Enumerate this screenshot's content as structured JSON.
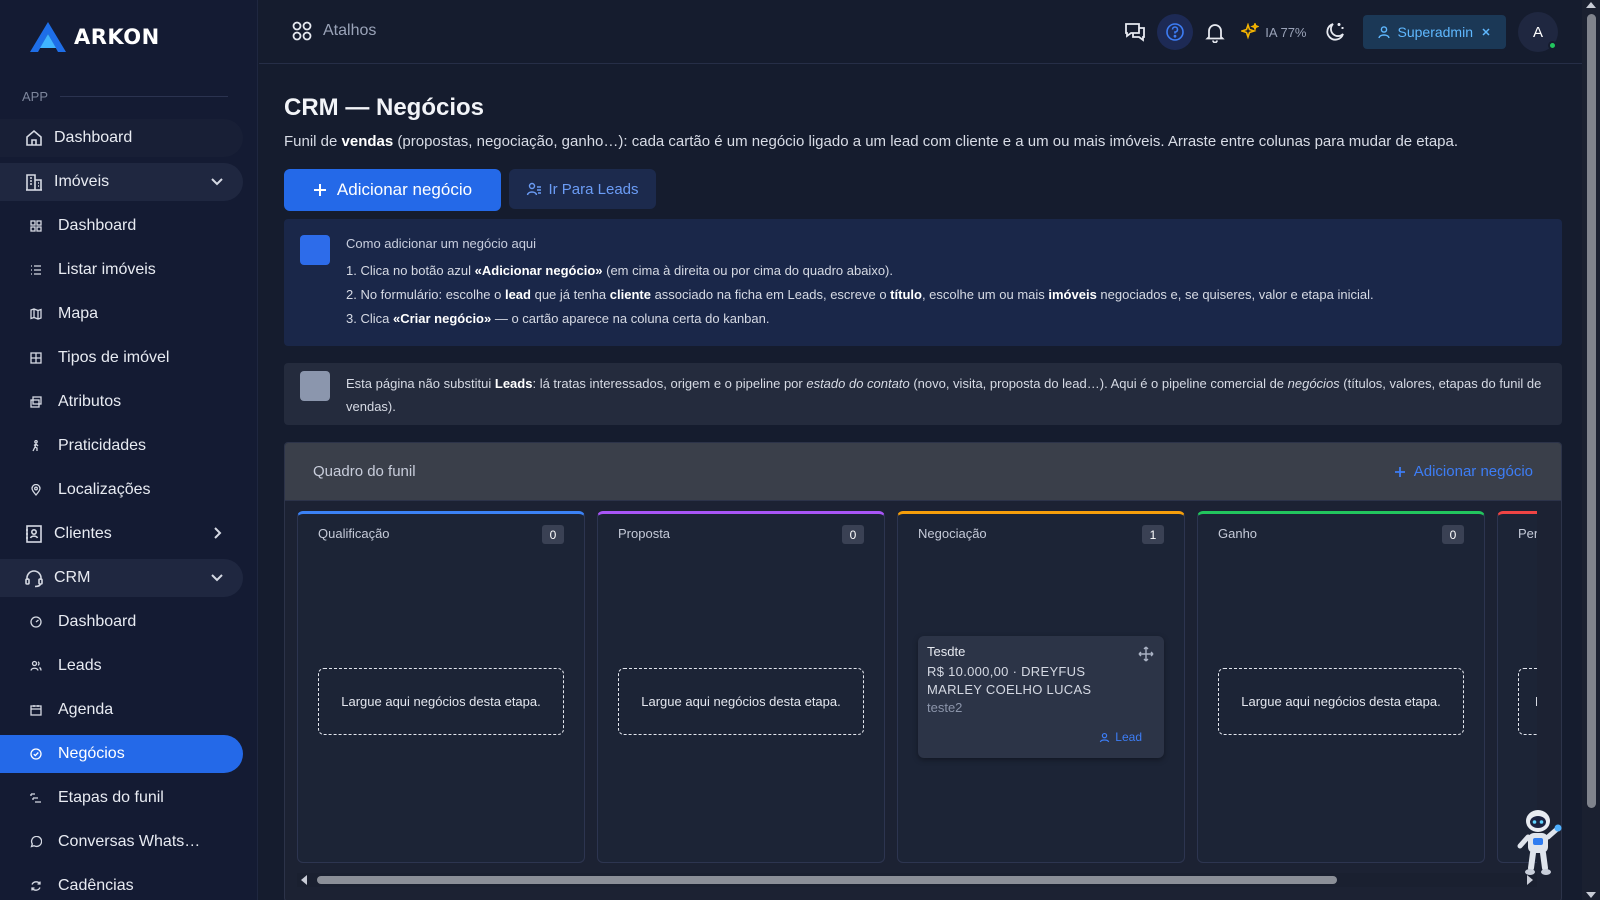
{
  "app": {
    "brand": "ARKON"
  },
  "sidebar": {
    "section_label": "APP",
    "items": [
      {
        "label": "Dashboard",
        "icon": "home-icon"
      },
      {
        "label": "Imóveis",
        "icon": "building-icon",
        "expanded": true
      },
      {
        "label": "Dashboard",
        "icon": "grid-icon"
      },
      {
        "label": "Listar imóveis",
        "icon": "list-icon"
      },
      {
        "label": "Mapa",
        "icon": "map-icon"
      },
      {
        "label": "Tipos de imóvel",
        "icon": "grid-icon"
      },
      {
        "label": "Atributos",
        "icon": "tags-icon"
      },
      {
        "label": "Praticidades",
        "icon": "person-walking-icon"
      },
      {
        "label": "Localizações",
        "icon": "pin-icon"
      },
      {
        "label": "Clientes",
        "icon": "address-book-icon",
        "expanded": false
      },
      {
        "label": "CRM",
        "icon": "headset-icon",
        "expanded": true
      },
      {
        "label": "Dashboard",
        "icon": "gauge-icon"
      },
      {
        "label": "Leads",
        "icon": "users-icon"
      },
      {
        "label": "Agenda",
        "icon": "calendar-icon"
      },
      {
        "label": "Negócios",
        "icon": "target-icon",
        "active": true
      },
      {
        "label": "Etapas do funil",
        "icon": "steps-icon"
      },
      {
        "label": "Conversas Whats…",
        "icon": "whatsapp-icon"
      },
      {
        "label": "Cadências",
        "icon": "refresh-icon"
      }
    ]
  },
  "topbar": {
    "shortcuts_label": "Atalhos",
    "ai_label": "IA 77%",
    "role_label": "Superadmin",
    "avatar_initial": "A"
  },
  "main": {
    "title": "CRM — Negócios",
    "desc_pre": "Funil de ",
    "desc_bold": "vendas",
    "desc_post": " (propostas, negociação, ganho…): cada cartão é um negócio ligado a um lead com cliente e a um ou mais imóveis. Arraste entre colunas para mudar de etapa.",
    "btn_add": "Adicionar negócio",
    "btn_leads": "Ir Para Leads",
    "info": {
      "title": "Como adicionar um negócio aqui",
      "step1_a": "1. Clica no botão azul ",
      "step1_b": "«Adicionar negócio»",
      "step1_c": " (em cima à direita ou por cima do quadro abaixo).",
      "step2_a": "2. No formulário: escolhe o ",
      "step2_b": "lead",
      "step2_c": " que já tenha ",
      "step2_d": "cliente",
      "step2_e": " associado na ficha em Leads, escreve o ",
      "step2_f": "título",
      "step2_g": ", escolhe um ou mais ",
      "step2_h": "imóveis",
      "step2_i": " negociados e, se quiseres, valor e etapa inicial.",
      "step3_a": "3. Clica ",
      "step3_b": "«Criar negócio»",
      "step3_c": " — o cartão aparece na coluna certa do kanban."
    },
    "note": {
      "a": "Esta página não substitui ",
      "b": "Leads",
      "c": ": lá tratas interessados, origem e o pipeline por ",
      "d": "estado do contato",
      "e": " (novo, visita, proposta do lead…). Aqui é o pipeline comercial de ",
      "f": "negócios",
      "g": " (títulos, valores, etapas do funil de vendas)."
    },
    "board": {
      "title": "Quadro do funil",
      "add_label": "Adicionar negócio",
      "dropzone_text": "Largue aqui negócios desta etapa.",
      "columns": [
        {
          "name": "Qualificação",
          "count": "0",
          "color": "#3b82f6"
        },
        {
          "name": "Proposta",
          "count": "0",
          "color": "#a855f7"
        },
        {
          "name": "Negociação",
          "count": "1",
          "color": "#f59e0b"
        },
        {
          "name": "Ganho",
          "count": "0",
          "color": "#22c55e"
        },
        {
          "name": "Perdi",
          "count": "",
          "color": "#ef4444"
        }
      ],
      "dropzone_partial": "La",
      "deal": {
        "title": "Tesdte",
        "line1": "R$ 10.000,00 · DREYFUS",
        "line2": "MARLEY COELHO LUCAS",
        "sub": "teste2",
        "lead_label": "Lead"
      }
    }
  }
}
